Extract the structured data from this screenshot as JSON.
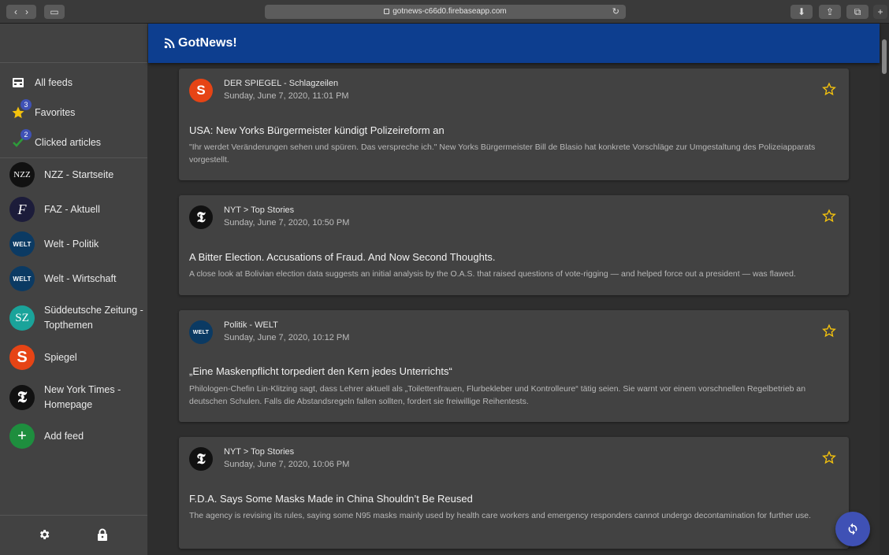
{
  "browser": {
    "url": "gotnews-c66d0.firebaseapp.com"
  },
  "app": {
    "title": "GotNews!"
  },
  "sidebar": {
    "special": [
      {
        "label": "All feeds",
        "badge": ""
      },
      {
        "label": "Favorites",
        "badge": "3"
      },
      {
        "label": "Clicked articles",
        "badge": "2"
      }
    ],
    "feeds": [
      {
        "label": "NZZ - Startseite",
        "logo": "NZZ"
      },
      {
        "label": "FAZ - Aktuell",
        "logo": "F"
      },
      {
        "label": "Welt - Politik",
        "logo": "WELT"
      },
      {
        "label": "Welt - Wirtschaft",
        "logo": "WELT"
      },
      {
        "label": "Süddeutsche Zeitung - Topthemen",
        "logo": "SZ"
      },
      {
        "label": "Spiegel",
        "logo": "S"
      },
      {
        "label": "New York Times - Homepage",
        "logo": "𝕿"
      }
    ],
    "add_feed": {
      "label": "Add feed",
      "logo": "+"
    }
  },
  "articles": [
    {
      "source": "DER SPIEGEL - Schlagzeilen",
      "logo": "S",
      "date": "Sunday, June 7, 2020, 11:01 PM",
      "title": "USA: New Yorks Bürgermeister kündigt Polizeireform an",
      "description": "\"Ihr werdet Veränderungen sehen und spüren. Das verspreche ich.\" New Yorks Bürgermeister Bill de Blasio hat konkrete Vorschläge zur Umgestaltung des Polizeiapparats vorgestellt."
    },
    {
      "source": "NYT > Top Stories",
      "logo": "𝕿",
      "date": "Sunday, June 7, 2020, 10:50 PM",
      "title": "A Bitter Election. Accusations of Fraud. And Now Second Thoughts.",
      "description": "A close look at Bolivian election data suggests an initial analysis by the O.A.S. that raised questions of vote-rigging — and helped force out a president — was flawed."
    },
    {
      "source": "Politik - WELT",
      "logo": "WELT",
      "date": "Sunday, June 7, 2020, 10:12 PM",
      "title": "„Eine Maskenpflicht torpediert den Kern jedes Unterrichts“",
      "description": "Philologen-Chefin Lin-Klitzing sagt, dass Lehrer aktuell als „Toilettenfrauen, Flurbekleber und Kontrolleure“ tätig seien. Sie warnt vor einem vorschnellen Regelbetrieb an deutschen Schulen. Falls die Abstandsregeln fallen sollten, fordert sie freiwillige Reihentests."
    },
    {
      "source": "NYT > Top Stories",
      "logo": "𝕿",
      "date": "Sunday, June 7, 2020, 10:06 PM",
      "title": "F.D.A. Says Some Masks Made in China Shouldn’t Be Reused",
      "description": "The agency is revising its rules, saying some N95 masks mainly used by health care workers and emergency responders cannot undergo decontamination for further use."
    }
  ],
  "colors": {
    "appbar": "#0d3e8f",
    "accent": "#3f51b5",
    "star": "#f4c20d"
  }
}
